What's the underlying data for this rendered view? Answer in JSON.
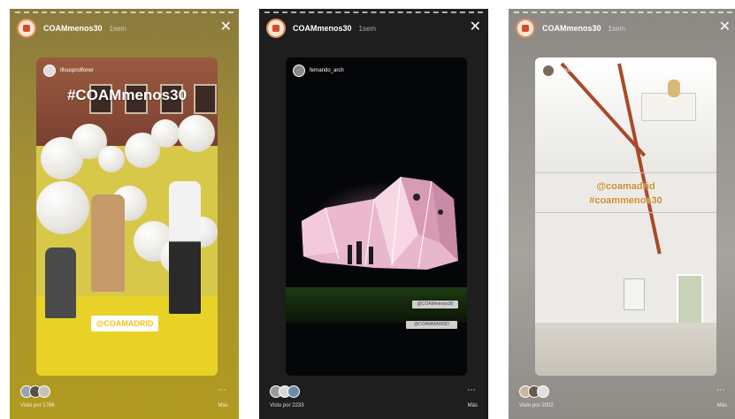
{
  "stories": [
    {
      "username": "COAMmenos30",
      "time": "1sem",
      "close_icon": "close-icon",
      "card_user": "iflousproffoner",
      "hashtag": "#COAMmenos30",
      "sticker": "@COAMADRID",
      "views": "Visto por 1766",
      "more_label": "Más"
    },
    {
      "username": "COAMmenos30",
      "time": "1sem",
      "close_icon": "close-icon",
      "card_user": "fernando_arch",
      "tag1": "@COAMmenos30",
      "tag2": "@COAMMADRID",
      "views": "Visto por 2233",
      "more_label": "Más"
    },
    {
      "username": "COAMmenos30",
      "time": "1sem",
      "close_icon": "close-icon",
      "card_user": "jabosamatilo",
      "line1": "@coamadrid",
      "line2": "#coammenos30",
      "views": "Visto por 2002",
      "more_label": "Más"
    }
  ]
}
